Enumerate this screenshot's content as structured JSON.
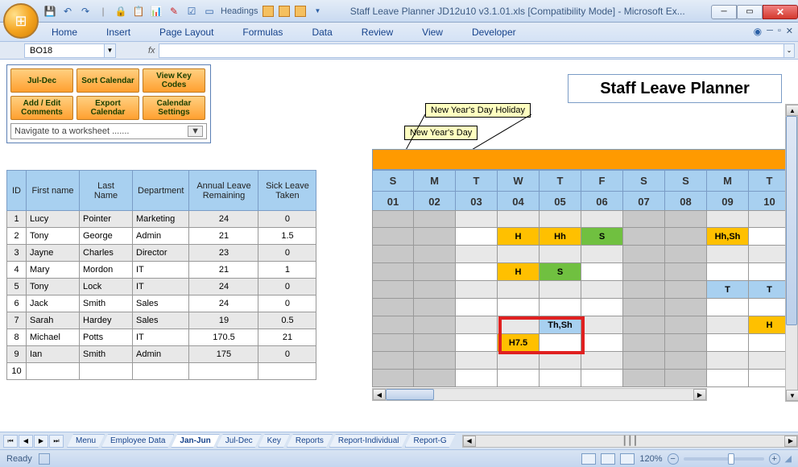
{
  "window": {
    "title": "Staff Leave Planner JD12u10 v3.1.01.xls  [Compatibility Mode] - Microsoft Ex...",
    "qat_headings_label": "Headings"
  },
  "ribbon": {
    "tabs": [
      "Home",
      "Insert",
      "Page Layout",
      "Formulas",
      "Data",
      "Review",
      "View",
      "Developer"
    ]
  },
  "namebox": {
    "value": "BO18"
  },
  "buttons": {
    "r1": [
      "Jul-Dec",
      "Sort Calendar",
      "View Key Codes"
    ],
    "r2": [
      "Add / Edit Comments",
      "Export Calendar",
      "Calendar Settings"
    ],
    "nav_placeholder": "Navigate to a worksheet .......",
    "dd": "▼"
  },
  "annotations": {
    "nyd_holiday": "New Year's Day Holiday",
    "nyd": "New Year's Day"
  },
  "title_band": "Staff Leave  Planner",
  "table": {
    "headers": {
      "id": "ID",
      "fn": "First name",
      "ln": "Last Name",
      "dep": "Department",
      "alr": "Annual Leave Remaining",
      "slt": "Sick Leave Taken"
    },
    "rows": [
      {
        "id": "1",
        "fn": "Lucy",
        "ln": "Pointer",
        "dep": "Marketing",
        "alr": "24",
        "slt": "0"
      },
      {
        "id": "2",
        "fn": "Tony",
        "ln": "George",
        "dep": "Admin",
        "alr": "21",
        "slt": "1.5"
      },
      {
        "id": "3",
        "fn": "Jayne",
        "ln": "Charles",
        "dep": "Director",
        "alr": "23",
        "slt": "0"
      },
      {
        "id": "4",
        "fn": "Mary",
        "ln": "Mordon",
        "dep": "IT",
        "alr": "21",
        "slt": "1"
      },
      {
        "id": "5",
        "fn": "Tony",
        "ln": "Lock",
        "dep": "IT",
        "alr": "24",
        "slt": "0"
      },
      {
        "id": "6",
        "fn": "Jack",
        "ln": "Smith",
        "dep": "Sales",
        "alr": "24",
        "slt": "0"
      },
      {
        "id": "7",
        "fn": "Sarah",
        "ln": "Hardey",
        "dep": "Sales",
        "alr": "19",
        "slt": "0.5"
      },
      {
        "id": "8",
        "fn": "Michael",
        "ln": "Potts",
        "dep": "IT",
        "alr": "170.5",
        "slt": "21"
      },
      {
        "id": "9",
        "fn": "Ian",
        "ln": "Smith",
        "dep": "Admin",
        "alr": "175",
        "slt": "0"
      },
      {
        "id": "10",
        "fn": "",
        "ln": "",
        "dep": "",
        "alr": "",
        "slt": ""
      }
    ]
  },
  "calendar": {
    "days": [
      "S",
      "M",
      "T",
      "W",
      "T",
      "F",
      "S",
      "S",
      "M",
      "T"
    ],
    "dates": [
      "01",
      "02",
      "03",
      "04",
      "05",
      "06",
      "07",
      "08",
      "09",
      "10"
    ],
    "cells": {
      "r1c3": {
        "text": "H",
        "bg": "orange"
      },
      "r1c4": {
        "text": "Hh",
        "bg": "orange"
      },
      "r1c5": {
        "text": "S",
        "bg": "green"
      },
      "r1c8": {
        "text": "Hh,Sh",
        "bg": "orange"
      },
      "r3c3": {
        "text": "H",
        "bg": "orange"
      },
      "r3c4": {
        "text": "S",
        "bg": "green"
      },
      "r4c8": {
        "text": "T",
        "bg": "blue"
      },
      "r4c9": {
        "text": "T",
        "bg": "blue"
      },
      "r6c4": {
        "text": "Th,Sh",
        "bg": "blue"
      },
      "r6c9": {
        "text": "H",
        "bg": "orange"
      },
      "r7c3": {
        "text": "H7.5",
        "bg": "orange"
      }
    }
  },
  "sheets": {
    "tabs": [
      "Menu",
      "Employee Data",
      "Jan-Jun",
      "Jul-Dec",
      "Key",
      "Reports",
      "Report-Individual",
      "Report-G"
    ],
    "active": 2
  },
  "status": {
    "ready": "Ready",
    "zoom": "120%",
    "minus": "−",
    "plus": "+"
  }
}
